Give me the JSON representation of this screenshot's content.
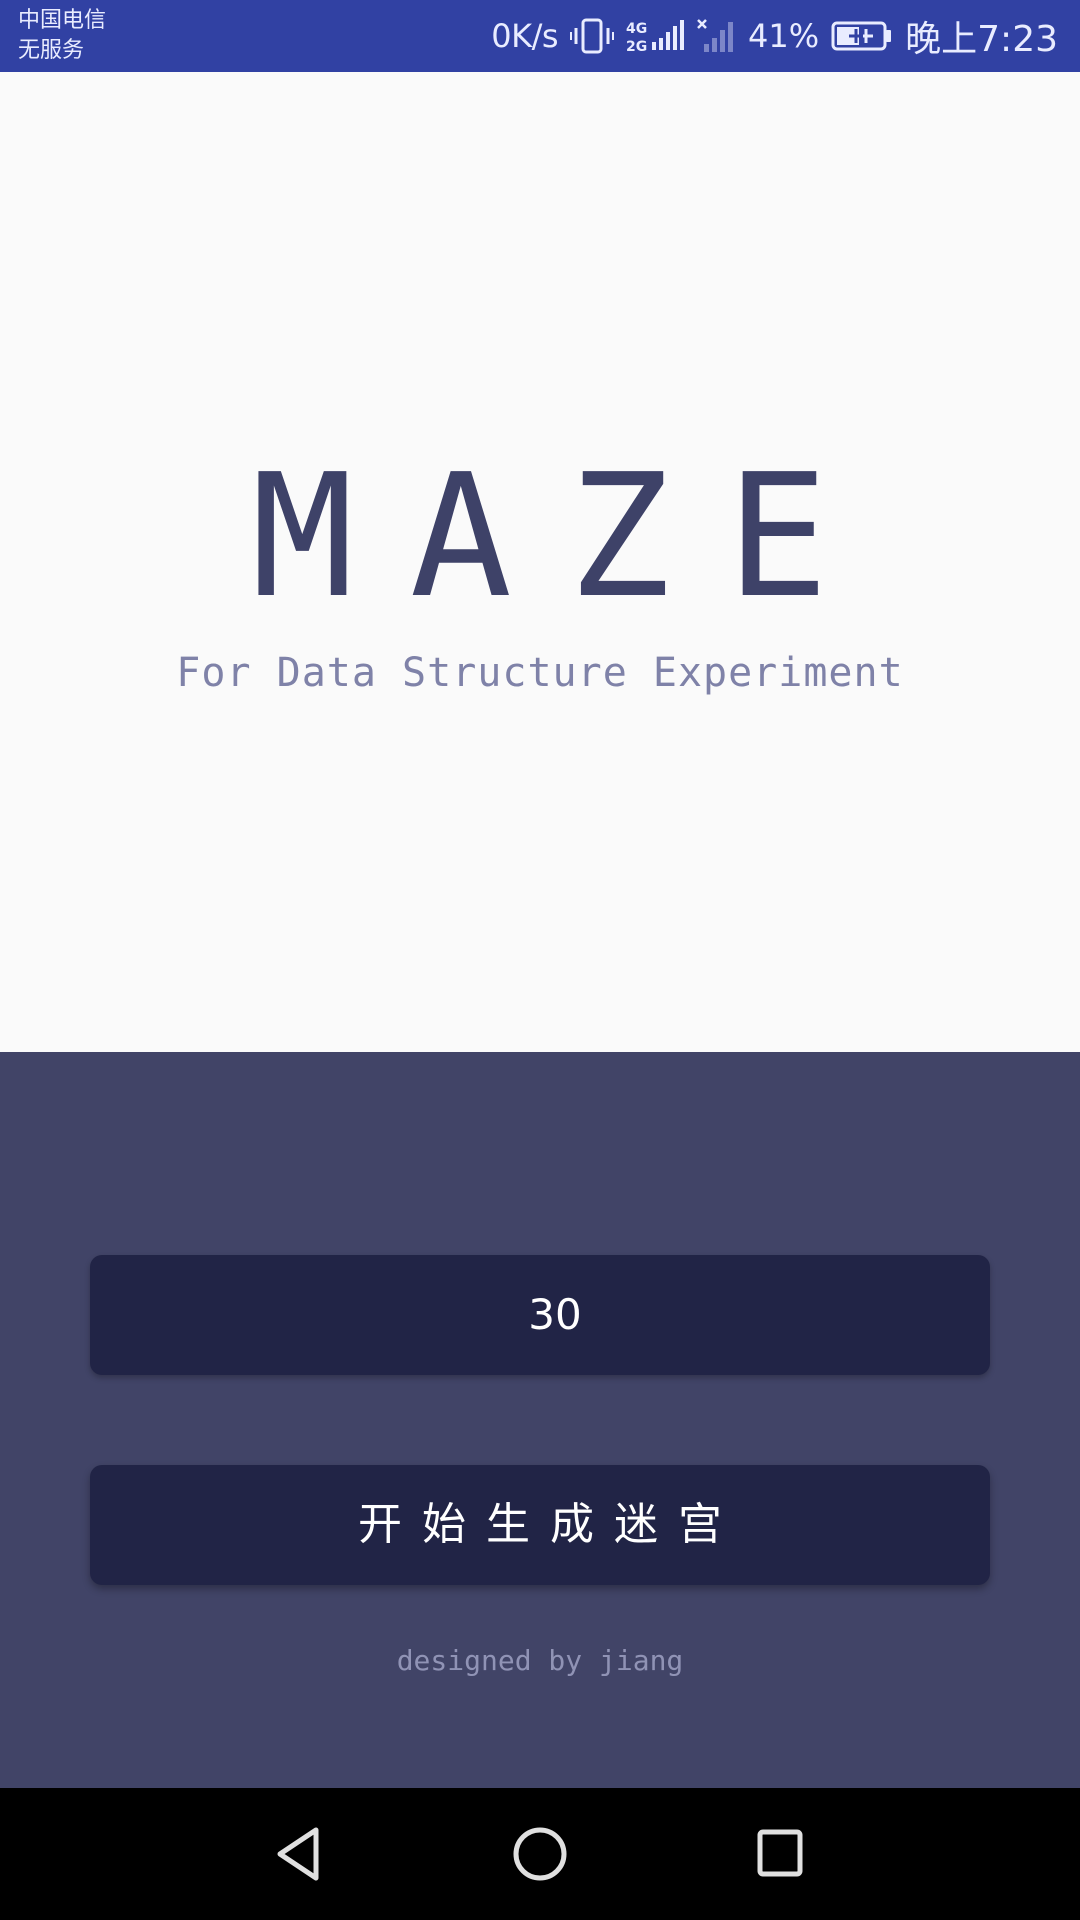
{
  "status_bar": {
    "carrier_line1": "中国电信",
    "carrier_line2": "无服务",
    "net_speed": "0K/s",
    "network_type": "4G 2G",
    "battery_percent": "41%",
    "time": "晚上7:23",
    "icons": [
      "vibrate-icon",
      "network-4g2g-icon",
      "signal-icon",
      "battery-icon"
    ]
  },
  "hero": {
    "title": "MAZE",
    "subtitle": "For Data Structure Experiment"
  },
  "controls": {
    "size_value": "30",
    "start_label": "开始生成迷宫",
    "credit": "designed by jiang"
  },
  "nav_bar": {
    "icons": [
      "back-icon",
      "home-icon",
      "recents-icon"
    ]
  },
  "colors": {
    "status_bar": "#3141a3",
    "hero_bg": "#fafafa",
    "title": "#3e4268",
    "subtitle": "#7f82a8",
    "panel_bg": "#414467",
    "button_bg": "#212446",
    "nav_bg": "#000000"
  }
}
